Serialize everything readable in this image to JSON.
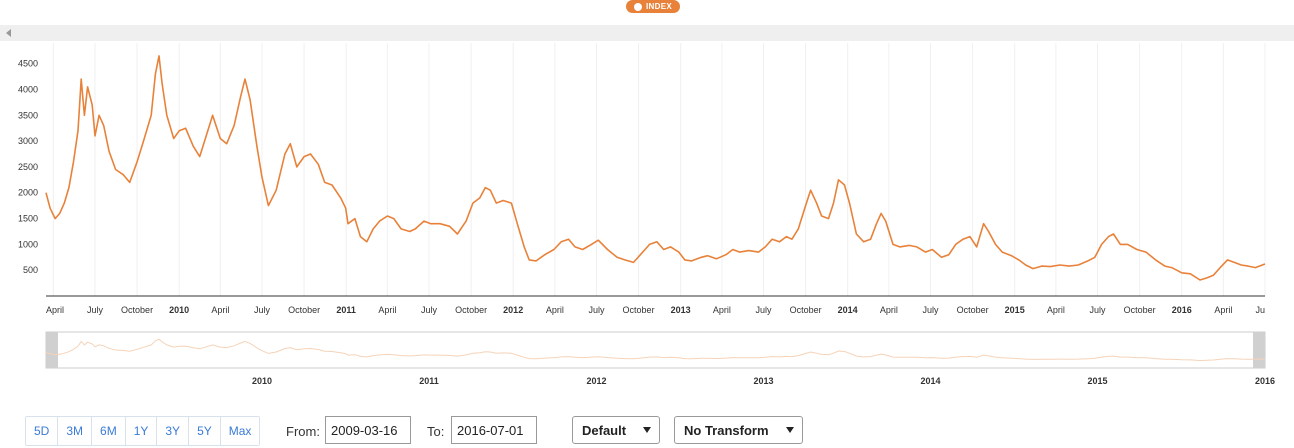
{
  "legend": {
    "label": "INDEX",
    "color": "#e8823a"
  },
  "chart_data": {
    "type": "line",
    "series": [
      {
        "name": "INDEX",
        "color": "#e8823a",
        "points": [
          [
            "2009-03-16",
            2000
          ],
          [
            "2009-03-25",
            1700
          ],
          [
            "2009-04-05",
            1500
          ],
          [
            "2009-04-15",
            1600
          ],
          [
            "2009-04-25",
            1800
          ],
          [
            "2009-05-05",
            2100
          ],
          [
            "2009-05-15",
            2600
          ],
          [
            "2009-05-25",
            3200
          ],
          [
            "2009-06-01",
            4200
          ],
          [
            "2009-06-08",
            3500
          ],
          [
            "2009-06-15",
            4050
          ],
          [
            "2009-06-25",
            3700
          ],
          [
            "2009-07-01",
            3100
          ],
          [
            "2009-07-10",
            3500
          ],
          [
            "2009-07-20",
            3300
          ],
          [
            "2009-08-01",
            2800
          ],
          [
            "2009-08-15",
            2450
          ],
          [
            "2009-09-01",
            2350
          ],
          [
            "2009-09-15",
            2200
          ],
          [
            "2009-10-01",
            2600
          ],
          [
            "2009-10-15",
            3000
          ],
          [
            "2009-11-01",
            3500
          ],
          [
            "2009-11-10",
            4300
          ],
          [
            "2009-11-18",
            4650
          ],
          [
            "2009-11-25",
            4100
          ],
          [
            "2009-12-05",
            3500
          ],
          [
            "2009-12-20",
            3050
          ],
          [
            "2010-01-01",
            3200
          ],
          [
            "2010-01-15",
            3250
          ],
          [
            "2010-02-01",
            2900
          ],
          [
            "2010-02-15",
            2700
          ],
          [
            "2010-03-01",
            3100
          ],
          [
            "2010-03-15",
            3500
          ],
          [
            "2010-04-01",
            3050
          ],
          [
            "2010-04-15",
            2950
          ],
          [
            "2010-05-01",
            3300
          ],
          [
            "2010-05-15",
            3850
          ],
          [
            "2010-05-25",
            4200
          ],
          [
            "2010-06-05",
            3800
          ],
          [
            "2010-06-20",
            2900
          ],
          [
            "2010-07-01",
            2300
          ],
          [
            "2010-07-15",
            1750
          ],
          [
            "2010-08-01",
            2050
          ],
          [
            "2010-08-20",
            2750
          ],
          [
            "2010-09-01",
            2950
          ],
          [
            "2010-09-15",
            2500
          ],
          [
            "2010-10-01",
            2700
          ],
          [
            "2010-10-15",
            2750
          ],
          [
            "2010-11-01",
            2550
          ],
          [
            "2010-11-15",
            2200
          ],
          [
            "2010-12-01",
            2150
          ],
          [
            "2010-12-20",
            1900
          ],
          [
            "2010-12-31",
            1700
          ],
          [
            "2011-01-05",
            1400
          ],
          [
            "2011-01-20",
            1500
          ],
          [
            "2011-02-01",
            1150
          ],
          [
            "2011-02-15",
            1050
          ],
          [
            "2011-03-01",
            1300
          ],
          [
            "2011-03-15",
            1450
          ],
          [
            "2011-04-01",
            1550
          ],
          [
            "2011-04-15",
            1500
          ],
          [
            "2011-05-01",
            1300
          ],
          [
            "2011-05-20",
            1250
          ],
          [
            "2011-06-01",
            1300
          ],
          [
            "2011-06-20",
            1450
          ],
          [
            "2011-07-05",
            1400
          ],
          [
            "2011-07-25",
            1400
          ],
          [
            "2011-08-15",
            1350
          ],
          [
            "2011-09-01",
            1200
          ],
          [
            "2011-09-20",
            1450
          ],
          [
            "2011-10-05",
            1800
          ],
          [
            "2011-10-20",
            1900
          ],
          [
            "2011-11-01",
            2100
          ],
          [
            "2011-11-12",
            2050
          ],
          [
            "2011-11-25",
            1800
          ],
          [
            "2011-12-10",
            1850
          ],
          [
            "2011-12-28",
            1800
          ],
          [
            "2012-01-10",
            1400
          ],
          [
            "2012-01-25",
            950
          ],
          [
            "2012-02-05",
            700
          ],
          [
            "2012-02-20",
            680
          ],
          [
            "2012-03-10",
            800
          ],
          [
            "2012-03-30",
            900
          ],
          [
            "2012-04-15",
            1050
          ],
          [
            "2012-05-01",
            1100
          ],
          [
            "2012-05-15",
            950
          ],
          [
            "2012-06-01",
            900
          ],
          [
            "2012-06-20",
            1000
          ],
          [
            "2012-07-05",
            1080
          ],
          [
            "2012-07-25",
            900
          ],
          [
            "2012-08-15",
            750
          ],
          [
            "2012-09-01",
            700
          ],
          [
            "2012-09-20",
            650
          ],
          [
            "2012-10-05",
            800
          ],
          [
            "2012-10-25",
            1000
          ],
          [
            "2012-11-10",
            1050
          ],
          [
            "2012-11-25",
            900
          ],
          [
            "2012-12-10",
            950
          ],
          [
            "2012-12-28",
            850
          ],
          [
            "2013-01-10",
            700
          ],
          [
            "2013-01-25",
            680
          ],
          [
            "2013-02-15",
            750
          ],
          [
            "2013-03-01",
            780
          ],
          [
            "2013-03-20",
            720
          ],
          [
            "2013-04-10",
            800
          ],
          [
            "2013-04-25",
            900
          ],
          [
            "2013-05-10",
            850
          ],
          [
            "2013-05-30",
            880
          ],
          [
            "2013-06-20",
            850
          ],
          [
            "2013-07-05",
            950
          ],
          [
            "2013-07-20",
            1100
          ],
          [
            "2013-08-05",
            1050
          ],
          [
            "2013-08-20",
            1150
          ],
          [
            "2013-09-01",
            1100
          ],
          [
            "2013-09-15",
            1300
          ],
          [
            "2013-10-01",
            1750
          ],
          [
            "2013-10-12",
            2050
          ],
          [
            "2013-10-25",
            1800
          ],
          [
            "2013-11-05",
            1550
          ],
          [
            "2013-11-20",
            1500
          ],
          [
            "2013-12-01",
            1800
          ],
          [
            "2013-12-12",
            2250
          ],
          [
            "2013-12-25",
            2150
          ],
          [
            "2014-01-05",
            1800
          ],
          [
            "2014-01-20",
            1200
          ],
          [
            "2014-02-05",
            1050
          ],
          [
            "2014-02-20",
            1100
          ],
          [
            "2014-03-05",
            1400
          ],
          [
            "2014-03-15",
            1600
          ],
          [
            "2014-03-25",
            1450
          ],
          [
            "2014-04-10",
            1000
          ],
          [
            "2014-04-25",
            950
          ],
          [
            "2014-05-15",
            980
          ],
          [
            "2014-06-01",
            950
          ],
          [
            "2014-06-20",
            850
          ],
          [
            "2014-07-05",
            900
          ],
          [
            "2014-07-25",
            750
          ],
          [
            "2014-08-10",
            800
          ],
          [
            "2014-08-25",
            1000
          ],
          [
            "2014-09-10",
            1100
          ],
          [
            "2014-09-25",
            1150
          ],
          [
            "2014-10-10",
            950
          ],
          [
            "2014-10-25",
            1400
          ],
          [
            "2014-11-05",
            1250
          ],
          [
            "2014-11-20",
            1000
          ],
          [
            "2014-12-05",
            850
          ],
          [
            "2014-12-25",
            780
          ],
          [
            "2015-01-10",
            700
          ],
          [
            "2015-01-25",
            600
          ],
          [
            "2015-02-10",
            530
          ],
          [
            "2015-03-01",
            580
          ],
          [
            "2015-03-20",
            570
          ],
          [
            "2015-04-10",
            600
          ],
          [
            "2015-04-30",
            580
          ],
          [
            "2015-05-20",
            600
          ],
          [
            "2015-06-10",
            680
          ],
          [
            "2015-06-25",
            750
          ],
          [
            "2015-07-10",
            1000
          ],
          [
            "2015-07-25",
            1150
          ],
          [
            "2015-08-05",
            1200
          ],
          [
            "2015-08-20",
            1000
          ],
          [
            "2015-09-05",
            1000
          ],
          [
            "2015-09-25",
            900
          ],
          [
            "2015-10-15",
            850
          ],
          [
            "2015-11-05",
            700
          ],
          [
            "2015-11-25",
            580
          ],
          [
            "2015-12-10",
            550
          ],
          [
            "2016-01-01",
            450
          ],
          [
            "2016-01-20",
            430
          ],
          [
            "2016-02-10",
            310
          ],
          [
            "2016-02-25",
            350
          ],
          [
            "2016-03-10",
            400
          ],
          [
            "2016-03-25",
            550
          ],
          [
            "2016-04-10",
            700
          ],
          [
            "2016-04-25",
            650
          ],
          [
            "2016-05-10",
            600
          ],
          [
            "2016-05-25",
            580
          ],
          [
            "2016-06-10",
            550
          ],
          [
            "2016-06-25",
            600
          ],
          [
            "2016-07-01",
            620
          ]
        ]
      }
    ],
    "y_ticks": [
      500,
      1000,
      1500,
      2000,
      2500,
      3000,
      3500,
      4000,
      4500
    ],
    "ylim": [
      0,
      4900
    ],
    "xlim": [
      "2009-03-16",
      "2016-07-01"
    ],
    "x_ticks": [
      {
        "label": "April",
        "date": "2009-04-01"
      },
      {
        "label": "July",
        "date": "2009-07-01"
      },
      {
        "label": "October",
        "date": "2009-10-01"
      },
      {
        "label": "2010",
        "date": "2010-01-01",
        "major": true
      },
      {
        "label": "April",
        "date": "2010-04-01"
      },
      {
        "label": "July",
        "date": "2010-07-01"
      },
      {
        "label": "October",
        "date": "2010-10-01"
      },
      {
        "label": "2011",
        "date": "2011-01-01",
        "major": true
      },
      {
        "label": "April",
        "date": "2011-04-01"
      },
      {
        "label": "July",
        "date": "2011-07-01"
      },
      {
        "label": "October",
        "date": "2011-10-01"
      },
      {
        "label": "2012",
        "date": "2012-01-01",
        "major": true
      },
      {
        "label": "April",
        "date": "2012-04-01"
      },
      {
        "label": "July",
        "date": "2012-07-01"
      },
      {
        "label": "October",
        "date": "2012-10-01"
      },
      {
        "label": "2013",
        "date": "2013-01-01",
        "major": true
      },
      {
        "label": "April",
        "date": "2013-04-01"
      },
      {
        "label": "July",
        "date": "2013-07-01"
      },
      {
        "label": "October",
        "date": "2013-10-01"
      },
      {
        "label": "2014",
        "date": "2014-01-01",
        "major": true
      },
      {
        "label": "April",
        "date": "2014-04-01"
      },
      {
        "label": "July",
        "date": "2014-07-01"
      },
      {
        "label": "October",
        "date": "2014-10-01"
      },
      {
        "label": "2015",
        "date": "2015-01-01",
        "major": true
      },
      {
        "label": "April",
        "date": "2015-04-01"
      },
      {
        "label": "July",
        "date": "2015-07-01"
      },
      {
        "label": "October",
        "date": "2015-10-01"
      },
      {
        "label": "2016",
        "date": "2016-01-01",
        "major": true
      },
      {
        "label": "April",
        "date": "2016-04-01"
      },
      {
        "label": "Ju",
        "date": "2016-07-01"
      }
    ],
    "navigator_ticks": [
      "2010",
      "2011",
      "2012",
      "2013",
      "2014",
      "2015",
      "2016"
    ],
    "grid": "vertical"
  },
  "range_selector": {
    "buttons": [
      "5D",
      "3M",
      "6M",
      "1Y",
      "3Y",
      "5Y",
      "Max"
    ],
    "from_label": "From:",
    "from_value": "2009-03-16",
    "to_label": "To:",
    "to_value": "2016-07-01"
  },
  "selects": {
    "mode": "Default",
    "transform": "No Transform"
  }
}
